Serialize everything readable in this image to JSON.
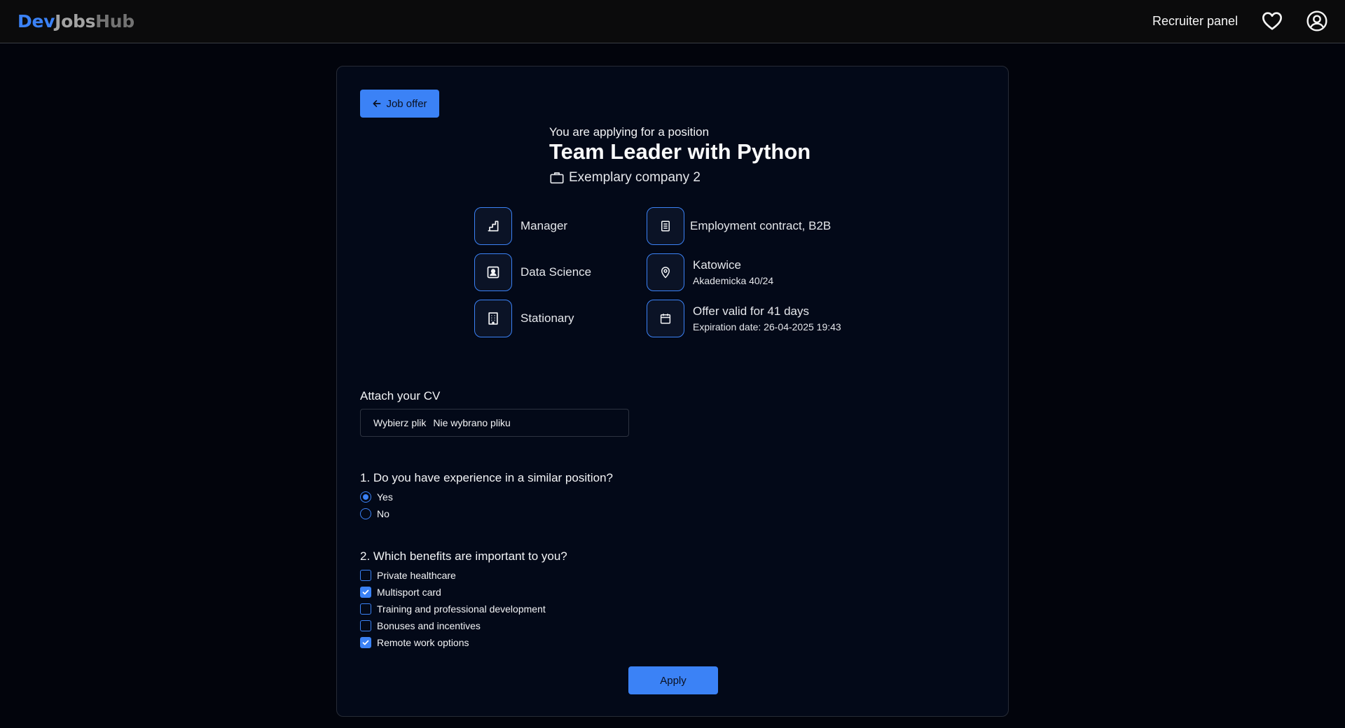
{
  "header": {
    "logo": {
      "part1": "Dev",
      "part2": "Jobs",
      "part3": "Hub"
    },
    "recruiter_panel": "Recruiter panel",
    "favorites_icon": "heart-icon",
    "account_icon": "user-circle-icon"
  },
  "back_button": {
    "label": "Job offer",
    "icon": "arrow-left-icon"
  },
  "offer": {
    "subtitle": "You are applying for a position",
    "title": "Team Leader with Python",
    "company": "Exemplary company 2",
    "left_attributes": [
      {
        "icon": "stairs-icon",
        "label": "Manager"
      },
      {
        "icon": "presentation-icon",
        "label": "Data Science"
      },
      {
        "icon": "building-icon",
        "label": "Stationary"
      }
    ],
    "right_attributes": [
      {
        "icon": "document-icon",
        "label": "Employment contract, B2B",
        "sub": ""
      },
      {
        "icon": "map-pin-icon",
        "label": "Katowice",
        "sub": "Akademicka 40/24"
      },
      {
        "icon": "calendar-icon",
        "label": "Offer valid for 41 days",
        "sub": "Expiration date: 26-04-2025 19:43"
      }
    ]
  },
  "cv": {
    "label": "Attach your CV",
    "choose_button": "Wybierz plik",
    "no_file": "Nie wybrano pliku"
  },
  "question1": {
    "text": "1. Do you have experience in a similar position?",
    "options": [
      {
        "label": "Yes",
        "selected": true
      },
      {
        "label": "No",
        "selected": false
      }
    ]
  },
  "question2": {
    "text": "2. Which benefits are important to you?",
    "options": [
      {
        "label": "Private healthcare",
        "checked": false
      },
      {
        "label": "Multisport card",
        "checked": true
      },
      {
        "label": "Training and professional development",
        "checked": false
      },
      {
        "label": "Bonuses and incentives",
        "checked": false
      },
      {
        "label": "Remote work options",
        "checked": true
      }
    ]
  },
  "apply_button": "Apply",
  "colors": {
    "accent": "#3b82f6",
    "background": "#02040c",
    "card": "#030918",
    "header": "#0b0b0c"
  }
}
